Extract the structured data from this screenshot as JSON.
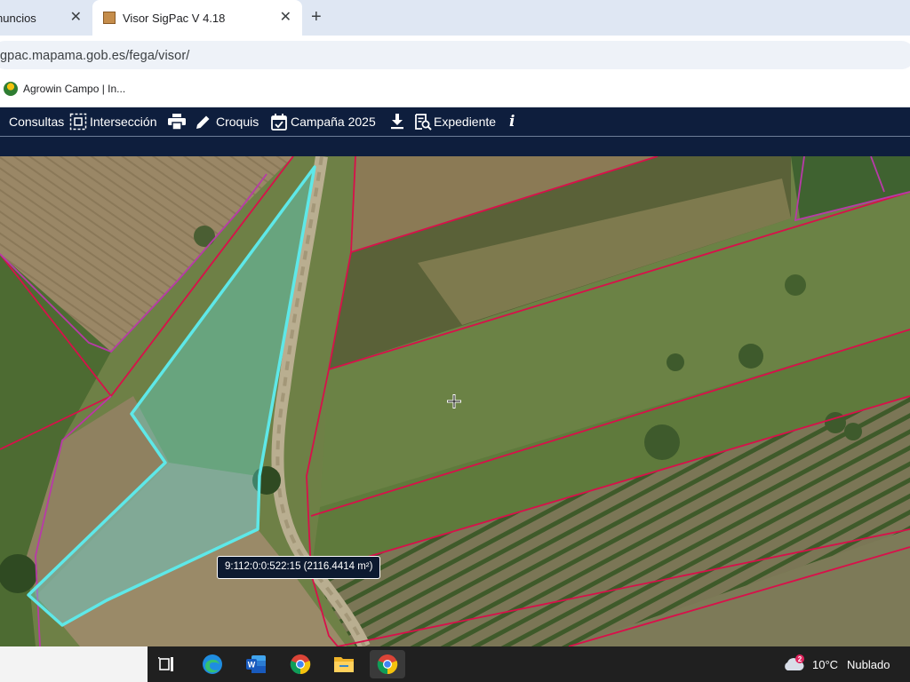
{
  "browser": {
    "tabs": [
      {
        "title": "nuncios",
        "active": false
      },
      {
        "title": "Visor SigPac V 4.18",
        "active": true
      }
    ],
    "new_tab_label": "+",
    "close_label": "✕",
    "url": "gpac.mapama.gob.es/fega/visor/",
    "bookmarks": [
      {
        "label": "Agrowin Campo | In..."
      }
    ]
  },
  "toolbar": {
    "items": [
      {
        "label": "Consultas"
      },
      {
        "label": "Intersección"
      },
      {
        "label": ""
      },
      {
        "label": "Croquis"
      },
      {
        "label": "Campaña 2025"
      },
      {
        "label": ""
      },
      {
        "label": "Expediente"
      },
      {
        "label": "i"
      }
    ]
  },
  "map": {
    "parcel_label": "9:112:0:0:522:15 (2116.4414 m²)",
    "colors": {
      "parcel_border": "#d8104a",
      "enclosure_border": "#b83aa8",
      "selection": "#5ee8e8"
    }
  },
  "taskbar": {
    "apps": [
      "task-view-icon",
      "edge-icon",
      "word-icon",
      "chrome-icon",
      "file-explorer-icon",
      "chrome-icon"
    ],
    "weather": {
      "badge": "2",
      "temperature": "10°C",
      "condition": "Nublado"
    }
  }
}
